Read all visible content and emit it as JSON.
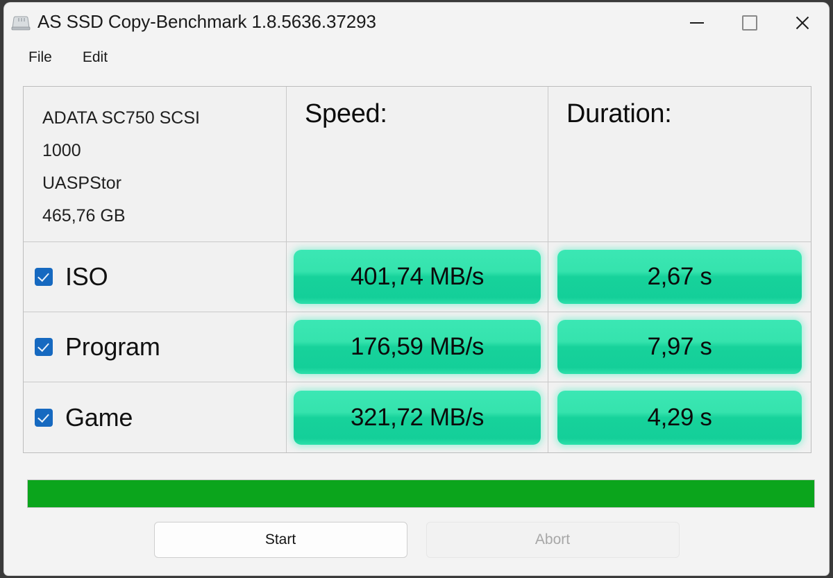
{
  "window": {
    "title": "AS SSD Copy-Benchmark 1.8.5636.37293",
    "icon": "ssd-drive-icon",
    "controls": {
      "minimize": "minimize-icon",
      "maximize": "maximize-icon",
      "close": "close-icon"
    }
  },
  "menu": {
    "items": [
      {
        "label": "File"
      },
      {
        "label": "Edit"
      }
    ]
  },
  "table": {
    "drive": {
      "model": "ADATA SC750 SCSI",
      "revision": "1000",
      "driver": "UASPStor",
      "capacity": "465,76 GB"
    },
    "headers": {
      "speed": "Speed:",
      "duration": "Duration:"
    },
    "rows": [
      {
        "label": "ISO",
        "checked": true,
        "speed": "401,74 MB/s",
        "duration": "2,67 s"
      },
      {
        "label": "Program",
        "checked": true,
        "speed": "176,59 MB/s",
        "duration": "7,97 s"
      },
      {
        "label": "Game",
        "checked": true,
        "speed": "321,72 MB/s",
        "duration": "4,29 s"
      }
    ]
  },
  "progress": {
    "percent": 100,
    "fill_width": "100%",
    "color": "#0ba51c"
  },
  "buttons": {
    "start": "Start",
    "abort": "Abort"
  },
  "colors": {
    "accent_pill_light": "#3be7b4",
    "accent_pill_dark": "#14cf99",
    "checkbox_blue": "#1669c0",
    "progress_green": "#0ba51c",
    "window_bg": "#f3f3f3"
  }
}
